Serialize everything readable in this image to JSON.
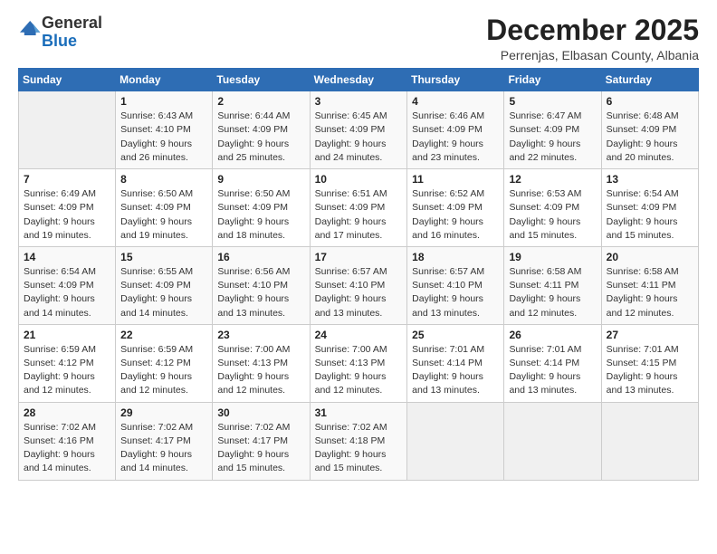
{
  "logo": {
    "general": "General",
    "blue": "Blue"
  },
  "header": {
    "month_year": "December 2025",
    "location": "Perrenjas, Elbasan County, Albania"
  },
  "weekdays": [
    "Sunday",
    "Monday",
    "Tuesday",
    "Wednesday",
    "Thursday",
    "Friday",
    "Saturday"
  ],
  "weeks": [
    [
      {
        "day": "",
        "sunrise": "",
        "sunset": "",
        "daylight": "",
        "empty": true
      },
      {
        "day": "1",
        "sunrise": "6:43 AM",
        "sunset": "4:10 PM",
        "daylight": "9 hours and 26 minutes."
      },
      {
        "day": "2",
        "sunrise": "6:44 AM",
        "sunset": "4:09 PM",
        "daylight": "9 hours and 25 minutes."
      },
      {
        "day": "3",
        "sunrise": "6:45 AM",
        "sunset": "4:09 PM",
        "daylight": "9 hours and 24 minutes."
      },
      {
        "day": "4",
        "sunrise": "6:46 AM",
        "sunset": "4:09 PM",
        "daylight": "9 hours and 23 minutes."
      },
      {
        "day": "5",
        "sunrise": "6:47 AM",
        "sunset": "4:09 PM",
        "daylight": "9 hours and 22 minutes."
      },
      {
        "day": "6",
        "sunrise": "6:48 AM",
        "sunset": "4:09 PM",
        "daylight": "9 hours and 20 minutes."
      }
    ],
    [
      {
        "day": "7",
        "sunrise": "6:49 AM",
        "sunset": "4:09 PM",
        "daylight": "9 hours and 19 minutes."
      },
      {
        "day": "8",
        "sunrise": "6:50 AM",
        "sunset": "4:09 PM",
        "daylight": "9 hours and 19 minutes."
      },
      {
        "day": "9",
        "sunrise": "6:50 AM",
        "sunset": "4:09 PM",
        "daylight": "9 hours and 18 minutes."
      },
      {
        "day": "10",
        "sunrise": "6:51 AM",
        "sunset": "4:09 PM",
        "daylight": "9 hours and 17 minutes."
      },
      {
        "day": "11",
        "sunrise": "6:52 AM",
        "sunset": "4:09 PM",
        "daylight": "9 hours and 16 minutes."
      },
      {
        "day": "12",
        "sunrise": "6:53 AM",
        "sunset": "4:09 PM",
        "daylight": "9 hours and 15 minutes."
      },
      {
        "day": "13",
        "sunrise": "6:54 AM",
        "sunset": "4:09 PM",
        "daylight": "9 hours and 15 minutes."
      }
    ],
    [
      {
        "day": "14",
        "sunrise": "6:54 AM",
        "sunset": "4:09 PM",
        "daylight": "9 hours and 14 minutes."
      },
      {
        "day": "15",
        "sunrise": "6:55 AM",
        "sunset": "4:09 PM",
        "daylight": "9 hours and 14 minutes."
      },
      {
        "day": "16",
        "sunrise": "6:56 AM",
        "sunset": "4:10 PM",
        "daylight": "9 hours and 13 minutes."
      },
      {
        "day": "17",
        "sunrise": "6:57 AM",
        "sunset": "4:10 PM",
        "daylight": "9 hours and 13 minutes."
      },
      {
        "day": "18",
        "sunrise": "6:57 AM",
        "sunset": "4:10 PM",
        "daylight": "9 hours and 13 minutes."
      },
      {
        "day": "19",
        "sunrise": "6:58 AM",
        "sunset": "4:11 PM",
        "daylight": "9 hours and 12 minutes."
      },
      {
        "day": "20",
        "sunrise": "6:58 AM",
        "sunset": "4:11 PM",
        "daylight": "9 hours and 12 minutes."
      }
    ],
    [
      {
        "day": "21",
        "sunrise": "6:59 AM",
        "sunset": "4:12 PM",
        "daylight": "9 hours and 12 minutes."
      },
      {
        "day": "22",
        "sunrise": "6:59 AM",
        "sunset": "4:12 PM",
        "daylight": "9 hours and 12 minutes."
      },
      {
        "day": "23",
        "sunrise": "7:00 AM",
        "sunset": "4:13 PM",
        "daylight": "9 hours and 12 minutes."
      },
      {
        "day": "24",
        "sunrise": "7:00 AM",
        "sunset": "4:13 PM",
        "daylight": "9 hours and 12 minutes."
      },
      {
        "day": "25",
        "sunrise": "7:01 AM",
        "sunset": "4:14 PM",
        "daylight": "9 hours and 13 minutes."
      },
      {
        "day": "26",
        "sunrise": "7:01 AM",
        "sunset": "4:14 PM",
        "daylight": "9 hours and 13 minutes."
      },
      {
        "day": "27",
        "sunrise": "7:01 AM",
        "sunset": "4:15 PM",
        "daylight": "9 hours and 13 minutes."
      }
    ],
    [
      {
        "day": "28",
        "sunrise": "7:02 AM",
        "sunset": "4:16 PM",
        "daylight": "9 hours and 14 minutes."
      },
      {
        "day": "29",
        "sunrise": "7:02 AM",
        "sunset": "4:17 PM",
        "daylight": "9 hours and 14 minutes."
      },
      {
        "day": "30",
        "sunrise": "7:02 AM",
        "sunset": "4:17 PM",
        "daylight": "9 hours and 15 minutes."
      },
      {
        "day": "31",
        "sunrise": "7:02 AM",
        "sunset": "4:18 PM",
        "daylight": "9 hours and 15 minutes."
      },
      {
        "day": "",
        "sunrise": "",
        "sunset": "",
        "daylight": "",
        "empty": true
      },
      {
        "day": "",
        "sunrise": "",
        "sunset": "",
        "daylight": "",
        "empty": true
      },
      {
        "day": "",
        "sunrise": "",
        "sunset": "",
        "daylight": "",
        "empty": true
      }
    ]
  ]
}
